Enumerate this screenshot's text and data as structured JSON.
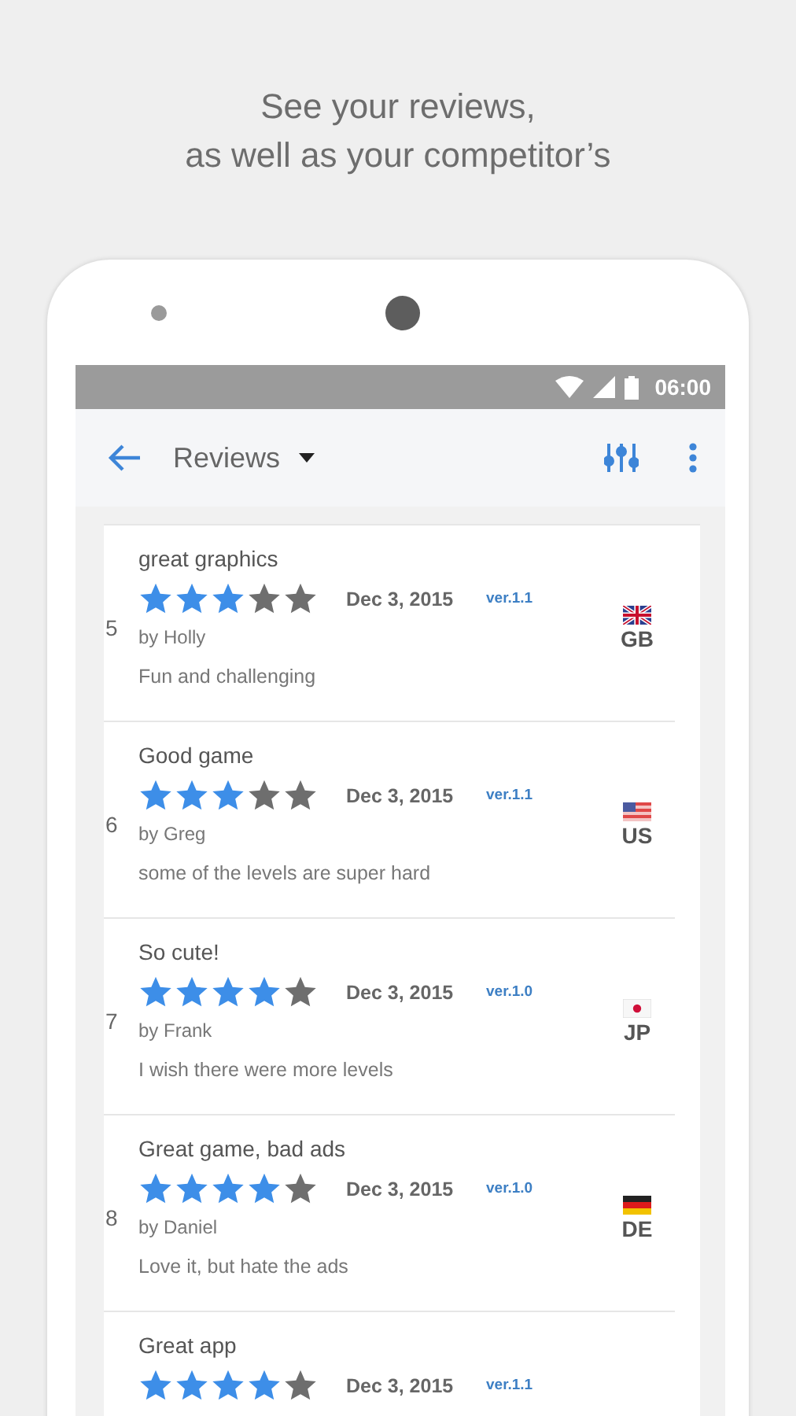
{
  "caption": [
    "See your reviews,",
    "as well as your competitor’s"
  ],
  "status_bar": {
    "time": "06:00"
  },
  "toolbar": {
    "title": "Reviews"
  },
  "reviews": [
    {
      "number": "5",
      "title": "great graphics",
      "stars": 3,
      "date": "Dec 3, 2015",
      "version": "ver.1.1",
      "author": "by Holly",
      "comment": "Fun and challenging",
      "kind": "gb",
      "country": "GB"
    },
    {
      "number": "6",
      "title": "Good game",
      "stars": 3,
      "date": "Dec 3, 2015",
      "version": "ver.1.1",
      "author": "by Greg",
      "comment": "some of the levels are super hard",
      "kind": "us",
      "country": "US"
    },
    {
      "number": "7",
      "title": "So cute!",
      "stars": 4,
      "date": "Dec 3, 2015",
      "version": "ver.1.0",
      "author": "by Frank",
      "comment": "I wish there were more levels",
      "kind": "jp",
      "country": "JP"
    },
    {
      "number": "8",
      "title": "Great game, bad ads",
      "stars": 4,
      "date": "Dec 3, 2015",
      "version": "ver.1.0",
      "author": "by Daniel",
      "comment": "Love it, but hate the ads",
      "kind": "de",
      "country": "DE"
    },
    {
      "title": "Great app",
      "stars": 4,
      "date": "Dec 3, 2015",
      "version": "ver.1.1"
    }
  ]
}
